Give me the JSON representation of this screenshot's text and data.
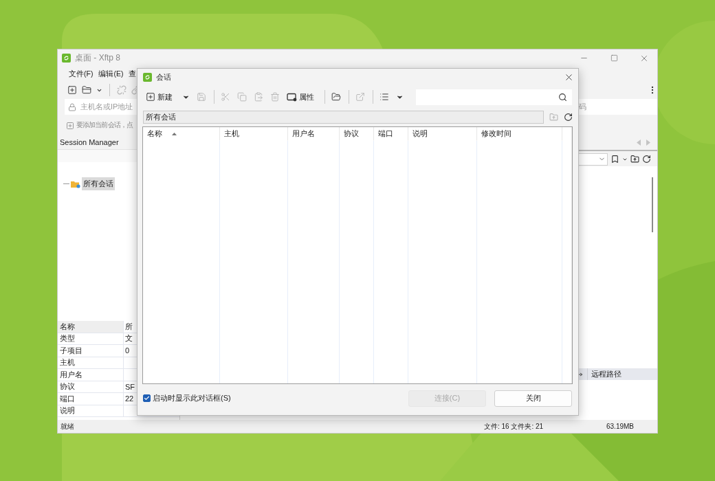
{
  "main_window": {
    "title": "桌面 - Xftp 8",
    "menu": [
      "文件(F)",
      "编辑(E)",
      "查"
    ],
    "host_placeholder": "主机名或IP地址",
    "password_placeholder": "码",
    "hint": "要添加当前会话，点",
    "session_manager": {
      "title": "Session Manager",
      "tree": [
        {
          "label": "所有会话",
          "selected": true
        }
      ]
    },
    "properties": [
      {
        "name": "名称",
        "value": "所"
      },
      {
        "name": "类型",
        "value": "文"
      },
      {
        "name": "子项目",
        "value": "0"
      },
      {
        "name": "主机"
      },
      {
        "name": "用户名"
      },
      {
        "name": "协议",
        "value": "SF"
      },
      {
        "name": "端口",
        "value": "22"
      },
      {
        "name": "说明"
      }
    ],
    "transfer_header": "远程路径",
    "status_bar": {
      "text": "就绪",
      "counts": "文件: 16 文件夹: 21",
      "size": "63.19MB"
    }
  },
  "dialog": {
    "title": "会话",
    "toolbar": [
      {
        "kind": "new",
        "label": "新建",
        "disabled": false
      },
      {
        "kind": "caret",
        "disabled": false
      },
      {
        "kind": "save",
        "disabled": true
      },
      {
        "kind": "separator"
      },
      {
        "kind": "cut",
        "disabled": true
      },
      {
        "kind": "copy",
        "disabled": true
      },
      {
        "kind": "paste",
        "disabled": true
      },
      {
        "kind": "delete",
        "disabled": true
      },
      {
        "kind": "properties",
        "label": "属性",
        "disabled": false
      },
      {
        "kind": "separator"
      },
      {
        "kind": "open",
        "disabled": false
      },
      {
        "kind": "separator"
      },
      {
        "kind": "export",
        "disabled": true
      },
      {
        "kind": "separator"
      },
      {
        "kind": "list",
        "disabled": false
      },
      {
        "kind": "caret",
        "disabled": false
      }
    ],
    "path": "所有会话",
    "columns": [
      {
        "label": "名称",
        "sorted": true
      },
      {
        "label": "主机",
        "sorted": false
      },
      {
        "label": "用户名",
        "sorted": false
      },
      {
        "label": "协议",
        "sorted": false
      },
      {
        "label": "端口",
        "sorted": false
      },
      {
        "label": "说明",
        "sorted": false
      },
      {
        "label": "修改时间",
        "sorted": false
      }
    ],
    "startup_checkbox": {
      "label": "启动时显示此对话框(S)",
      "checked": true
    },
    "buttons": [
      {
        "label": "连接(C)",
        "disabled": true
      },
      {
        "label": "关闭",
        "disabled": false
      }
    ]
  }
}
